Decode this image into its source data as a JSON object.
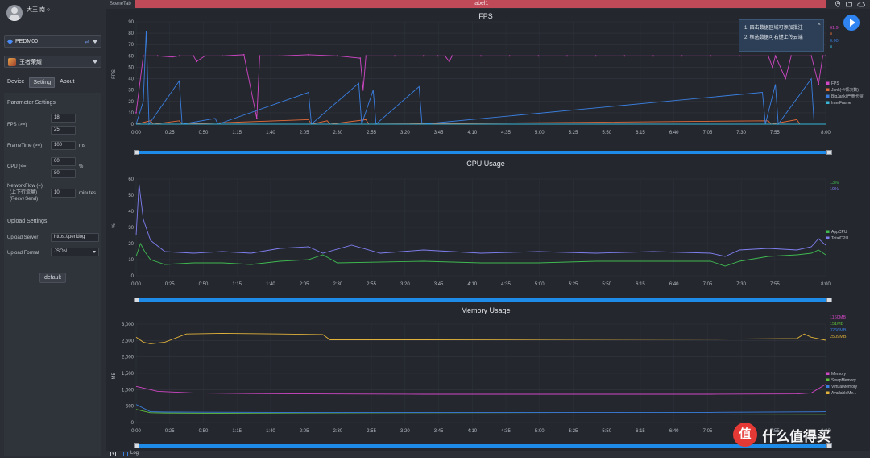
{
  "user": {
    "name": "大王 南 ○"
  },
  "device": {
    "selected": "PEDM00"
  },
  "app": {
    "selected": "王者荣耀"
  },
  "tabs": [
    "Device",
    "Setting",
    "About"
  ],
  "settings": {
    "parameter_title": "Parameter Settings",
    "fps_label": "FPS (>=)",
    "fps_values": [
      "18",
      "25"
    ],
    "frametime_label": "FrameTime (>=)",
    "frametime_value": "100",
    "frametime_unit": "ms",
    "cpu_label": "CPU (<=)",
    "cpu_values": [
      "60",
      "80"
    ],
    "cpu_unit": "%",
    "netflow_label": "NetworkFlow (=)",
    "netflow_sub1": "(上下行流量)",
    "netflow_sub2": "(Recv+Send)",
    "netflow_value": "10",
    "netflow_unit": "minutes",
    "upload_title": "Upload Settings",
    "upload_server_label": "Upload Server",
    "upload_server_value": "https://perfdog",
    "upload_format_label": "Upload Format",
    "upload_format_value": "JSON",
    "default_button": "default"
  },
  "top": {
    "scene_tab": "SceneTab",
    "label": "label1"
  },
  "tooltip": {
    "line1": "1. 四击数据区域可添加批注",
    "line2": "2. 框选数据可右键上传云端",
    "close": "×"
  },
  "bottom": {
    "log_label": "Log"
  },
  "watermark": {
    "text": "什么值得买",
    "logo": "值"
  },
  "colors": {
    "accent": "#1e8be8",
    "label_bar": "#c14a59",
    "fps": "#d147c6",
    "cpu_app": "#3fb950",
    "cpu_total": "#7f7ff0",
    "mem_avail": "#e0b23a"
  },
  "time_ticks": [
    "0:00",
    "0:25",
    "0:50",
    "1:15",
    "1:40",
    "2:05",
    "2:30",
    "2:55",
    "3:20",
    "3:45",
    "4:10",
    "4:35",
    "5:00",
    "5:25",
    "5:50",
    "6:15",
    "6:40",
    "7:05",
    "7:30",
    "7:55",
    "8:00"
  ],
  "chart_data": [
    {
      "type": "line",
      "title": "FPS",
      "ylabel": "FPS",
      "ylim": [
        0,
        90
      ],
      "yticks": [
        "0",
        "10",
        "20",
        "30",
        "40",
        "50",
        "60",
        "70",
        "80",
        "90"
      ],
      "legend": [
        "FPS",
        "Jank(卡顿次数)",
        "BigJank(严重卡顿)",
        "InterFrame"
      ],
      "current_values": [
        "61.9",
        "0",
        "0.00",
        "0"
      ],
      "series": [
        {
          "name": "FPS",
          "color": "#d147c6",
          "points": [
            [
              0,
              10
            ],
            [
              5,
              60
            ],
            [
              15,
              60
            ],
            [
              25,
              59
            ],
            [
              30,
              60
            ],
            [
              40,
              60
            ],
            [
              42,
              55
            ],
            [
              48,
              60
            ],
            [
              60,
              60
            ],
            [
              75,
              61
            ],
            [
              84,
              5
            ],
            [
              86,
              60
            ],
            [
              100,
              60
            ],
            [
              120,
              61
            ],
            [
              140,
              60
            ],
            [
              156,
              58
            ],
            [
              158,
              30
            ],
            [
              160,
              60
            ],
            [
              180,
              60
            ],
            [
              200,
              60
            ],
            [
              210,
              60
            ],
            [
              215,
              60
            ],
            [
              218,
              55
            ],
            [
              220,
              60
            ],
            [
              240,
              60
            ],
            [
              260,
              60
            ],
            [
              280,
              60
            ],
            [
              300,
              60
            ],
            [
              320,
              60
            ],
            [
              340,
              60
            ],
            [
              360,
              60
            ],
            [
              380,
              60
            ],
            [
              400,
              60
            ],
            [
              420,
              60
            ],
            [
              440,
              60
            ],
            [
              443,
              50
            ],
            [
              445,
              60
            ],
            [
              452,
              40
            ],
            [
              456,
              60
            ],
            [
              470,
              60
            ],
            [
              475,
              35
            ],
            [
              478,
              60
            ],
            [
              480,
              60
            ]
          ]
        },
        {
          "name": "Jank(卡顿次数)",
          "color": "#e06c3a",
          "points": [
            [
              0,
              0
            ],
            [
              10,
              3
            ],
            [
              12,
              0
            ],
            [
              30,
              3
            ],
            [
              32,
              0
            ],
            [
              120,
              4
            ],
            [
              122,
              0
            ],
            [
              133,
              3
            ],
            [
              135,
              0
            ],
            [
              160,
              4
            ],
            [
              162,
              0
            ],
            [
              440,
              3
            ],
            [
              442,
              0
            ],
            [
              460,
              4
            ],
            [
              462,
              0
            ],
            [
              480,
              0
            ]
          ]
        },
        {
          "name": "BigJank(严重卡顿)",
          "color": "#3a7fe0",
          "points": [
            [
              0,
              0
            ],
            [
              5,
              20
            ],
            [
              7,
              82
            ],
            [
              9,
              0
            ],
            [
              30,
              38
            ],
            [
              32,
              0
            ],
            [
              55,
              5
            ],
            [
              57,
              0
            ],
            [
              120,
              28
            ],
            [
              122,
              0
            ],
            [
              155,
              36
            ],
            [
              157,
              0
            ],
            [
              165,
              30
            ],
            [
              167,
              0
            ],
            [
              197,
              33
            ],
            [
              199,
              0
            ],
            [
              436,
              28
            ],
            [
              438,
              0
            ],
            [
              445,
              35
            ],
            [
              447,
              0
            ],
            [
              470,
              40
            ],
            [
              472,
              0
            ],
            [
              480,
              0
            ]
          ]
        },
        {
          "name": "InterFrame",
          "color": "#39b6d6",
          "points": [
            [
              0,
              0
            ],
            [
              480,
              0
            ]
          ]
        }
      ]
    },
    {
      "type": "line",
      "title": "CPU Usage",
      "ylabel": "%",
      "ylim": [
        0,
        60
      ],
      "yticks": [
        "0",
        "10",
        "20",
        "30",
        "40",
        "50",
        "60"
      ],
      "legend": [
        "AppCPU",
        "TotalCPU"
      ],
      "current_values": [
        "13%",
        "19%"
      ],
      "series": [
        {
          "name": "AppCPU",
          "color": "#3fb950",
          "points": [
            [
              0,
              12
            ],
            [
              3,
              20
            ],
            [
              6,
              15
            ],
            [
              10,
              10
            ],
            [
              20,
              7
            ],
            [
              40,
              8
            ],
            [
              60,
              8
            ],
            [
              80,
              7
            ],
            [
              100,
              9
            ],
            [
              120,
              10
            ],
            [
              130,
              13
            ],
            [
              140,
              8
            ],
            [
              200,
              9
            ],
            [
              240,
              8
            ],
            [
              280,
              8
            ],
            [
              320,
              9
            ],
            [
              360,
              9
            ],
            [
              400,
              9
            ],
            [
              410,
              6
            ],
            [
              420,
              9
            ],
            [
              440,
              12
            ],
            [
              460,
              13
            ],
            [
              470,
              14
            ],
            [
              475,
              16
            ],
            [
              480,
              13
            ]
          ]
        },
        {
          "name": "TotalCPU",
          "color": "#7f7ff0",
          "points": [
            [
              0,
              25
            ],
            [
              2,
              57
            ],
            [
              5,
              35
            ],
            [
              10,
              22
            ],
            [
              20,
              15
            ],
            [
              40,
              14
            ],
            [
              60,
              15
            ],
            [
              80,
              14
            ],
            [
              100,
              17
            ],
            [
              120,
              18
            ],
            [
              130,
              14
            ],
            [
              150,
              19
            ],
            [
              170,
              14
            ],
            [
              200,
              16
            ],
            [
              240,
              14
            ],
            [
              280,
              15
            ],
            [
              320,
              14
            ],
            [
              360,
              15
            ],
            [
              400,
              14
            ],
            [
              410,
              12
            ],
            [
              420,
              16
            ],
            [
              440,
              17
            ],
            [
              460,
              16
            ],
            [
              470,
              18
            ],
            [
              475,
              23
            ],
            [
              480,
              19
            ]
          ]
        }
      ]
    },
    {
      "type": "line",
      "title": "Memory Usage",
      "ylabel": "MB",
      "ylim": [
        0,
        3000
      ],
      "yticks": [
        "0",
        "500",
        "1,000",
        "1,500",
        "2,000",
        "2,500",
        "3,000"
      ],
      "legend": [
        "Memory",
        "SwapMemory",
        "VirtualMemory",
        "AvailableMe..."
      ],
      "current_values": [
        "1160MB",
        "151MB",
        "3266MB",
        "2509MB"
      ],
      "series": [
        {
          "name": "Memory",
          "color": "#d147c6",
          "points": [
            [
              0,
              1100
            ],
            [
              5,
              1050
            ],
            [
              15,
              950
            ],
            [
              40,
              900
            ],
            [
              80,
              880
            ],
            [
              120,
              870
            ],
            [
              200,
              860
            ],
            [
              300,
              860
            ],
            [
              400,
              860
            ],
            [
              460,
              870
            ],
            [
              470,
              900
            ],
            [
              480,
              1160
            ]
          ]
        },
        {
          "name": "SwapMemory",
          "color": "#5fbf3a",
          "points": [
            [
              0,
              400
            ],
            [
              5,
              350
            ],
            [
              10,
              300
            ],
            [
              20,
              290
            ],
            [
              60,
              280
            ],
            [
              120,
              270
            ],
            [
              200,
              265
            ],
            [
              300,
              260
            ],
            [
              400,
              255
            ],
            [
              480,
              250
            ]
          ]
        },
        {
          "name": "VirtualMemory",
          "color": "#3a7fe0",
          "points": [
            [
              0,
              550
            ],
            [
              10,
              330
            ],
            [
              20,
              320
            ],
            [
              100,
              310
            ],
            [
              200,
              305
            ],
            [
              300,
              305
            ],
            [
              400,
              310
            ],
            [
              480,
              330
            ]
          ]
        },
        {
          "name": "AvailableMe...",
          "color": "#e0b23a",
          "points": [
            [
              0,
              2600
            ],
            [
              5,
              2450
            ],
            [
              10,
              2400
            ],
            [
              20,
              2450
            ],
            [
              35,
              2700
            ],
            [
              60,
              2720
            ],
            [
              100,
              2700
            ],
            [
              130,
              2680
            ],
            [
              135,
              2520
            ],
            [
              200,
              2520
            ],
            [
              300,
              2530
            ],
            [
              400,
              2540
            ],
            [
              460,
              2560
            ],
            [
              465,
              2700
            ],
            [
              470,
              2600
            ],
            [
              480,
              2509
            ]
          ]
        }
      ]
    }
  ]
}
